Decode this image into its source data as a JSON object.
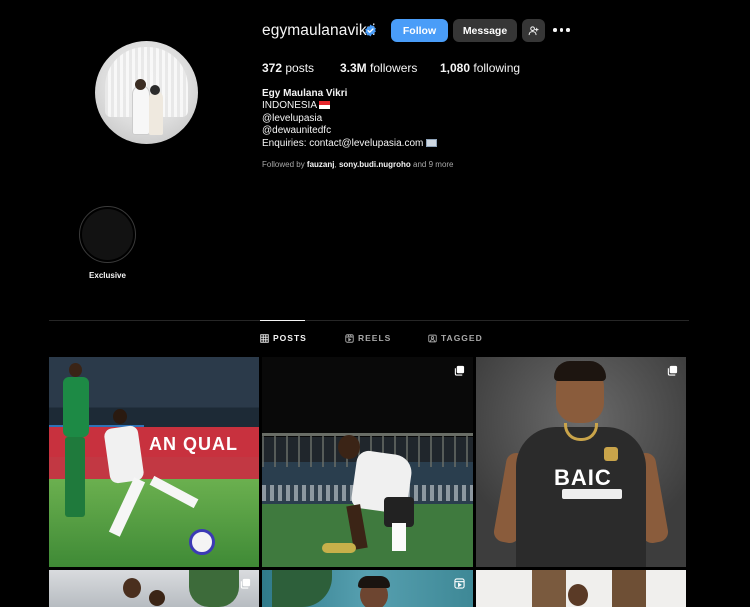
{
  "profile": {
    "username": "egymaulanavikri",
    "verified": true,
    "follow_label": "Follow",
    "message_label": "Message",
    "stats": {
      "posts_count": "372",
      "posts_label": "posts",
      "followers_count": "3.3M",
      "followers_label": "followers",
      "following_count": "1,080",
      "following_label": "following"
    },
    "bio": {
      "full_name": "Egy Maulana Vikri",
      "line1": "INDONESIA",
      "line2": "@levelupasia",
      "line3": "@dewaunitedfc",
      "line4": "Enquiries: contact@levelupasia.com"
    },
    "followed_by": {
      "prefix": "Followed by",
      "user1": "fauzanj",
      "sep": ",",
      "user2": "sony.budi.nugroho",
      "suffix": "and 9 more"
    }
  },
  "highlights": [
    {
      "label": "Exclusive"
    }
  ],
  "tabs": [
    {
      "label": "POSTS",
      "icon": "grid-icon",
      "active": true
    },
    {
      "label": "REELS",
      "icon": "reels-icon",
      "active": false
    },
    {
      "label": "TAGGED",
      "icon": "tagged-icon",
      "active": false
    }
  ],
  "posts": {
    "post1_board_text": "AN QUAL",
    "post3_jersey_text": "BAIC"
  },
  "colors": {
    "background": "#000000",
    "follow_button": "#4a9df8",
    "secondary_button": "#363636",
    "verified_badge": "#4a9df8",
    "muted_text": "#a8a8a8"
  }
}
